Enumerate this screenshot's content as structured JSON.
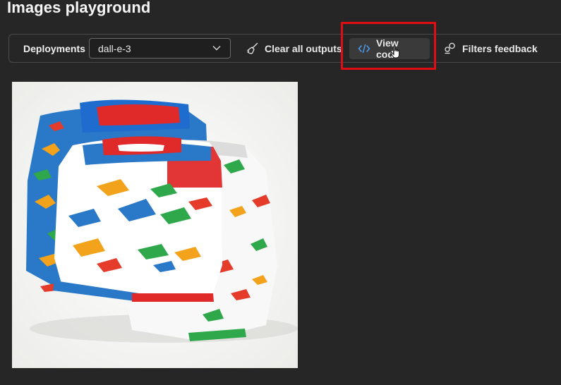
{
  "page": {
    "title": "Images playground"
  },
  "toolbar": {
    "deployments_label": "Deployments",
    "deployment_value": "dall-e-3",
    "clear_label": "Clear all outputs",
    "view_code_label": "View code",
    "filters_label": "Filters feedback"
  },
  "icons": {
    "dropdown": "chevron-down-icon",
    "clear": "broom-icon",
    "view_code": "code-icon",
    "filters": "filters-feedback-icon"
  },
  "colors": {
    "background": "#262626",
    "highlight": "#e00e13",
    "code_icon": "#4aa3ff"
  }
}
